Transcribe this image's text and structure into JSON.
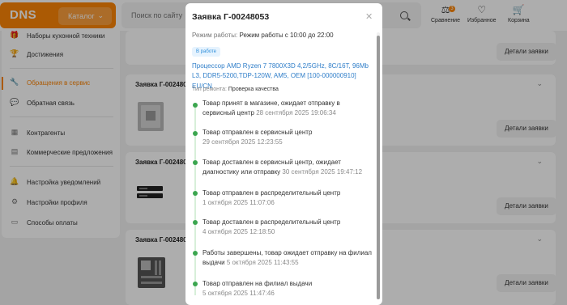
{
  "header": {
    "logo": "DNS",
    "catalog_label": "Каталог",
    "search_placeholder": "Поиск по сайту",
    "compare_label": "Сравнение",
    "compare_count": "3",
    "favorites_label": "Избранное",
    "cart_label": "Корзина"
  },
  "sidebar": {
    "items": [
      {
        "label": "Наборы кухонной техники",
        "icon": "gift-icon"
      },
      {
        "label": "Достижения",
        "icon": "trophy-icon"
      },
      {
        "label": "Обращения в сервис",
        "icon": "wrench-icon",
        "active": true
      },
      {
        "label": "Обратная связь",
        "icon": "chat-icon"
      },
      {
        "label": "Контрагенты",
        "icon": "building-icon"
      },
      {
        "label": "Коммерческие предложения",
        "icon": "document-icon"
      },
      {
        "label": "Настройка уведомлений",
        "icon": "bell-icon"
      },
      {
        "label": "Настройки профиля",
        "icon": "gear-icon"
      },
      {
        "label": "Способы оплаты",
        "icon": "wallet-icon"
      }
    ]
  },
  "main": {
    "details_label": "Детали заявки",
    "cards": [
      {
        "title": "Заявка Г-002480"
      },
      {
        "title": "Заявка Г-002480"
      },
      {
        "title": "Заявка Г-002480"
      }
    ]
  },
  "modal": {
    "title": "Заявка Г-00248053",
    "hours_label": "Режим работы:",
    "hours_value": "Режим работы с 10:00 до 22:00",
    "status": "В работе",
    "product": "Процессор AMD Ryzen 7 7800X3D 4,2/5GHz, 8C/16T, 96Mb L3, DDR5-5200,TDP-120W, AM5, OEM [100-000000910] EU/CN",
    "repair_label": "Тип ремонта:",
    "repair_value": "Проверка качества",
    "timeline": [
      {
        "text": "Товар принят в магазине, ожидает отправку в сервисный центр",
        "date": "28 сентября 2025 19:06:34"
      },
      {
        "text": "Товар отправлен в сервисный центр",
        "date": "29 сентября 2025 12:23:55"
      },
      {
        "text": "Товар доставлен в сервисный центр, ожидает диагностику или отправку",
        "date": "30 сентября 2025 19:47:12"
      },
      {
        "text": "Товар отправлен в распределительный центр",
        "date": "1 октября 2025 11:07:06"
      },
      {
        "text": "Товар доставлен в распределительный центр",
        "date": "4 октября 2025 12:18:50"
      },
      {
        "text": "Работы завершены, товар ожидает отправку на филиал выдачи",
        "date": "5 октября 2025 11:43:55"
      },
      {
        "text": "Товар отправлен на филиал выдачи",
        "date": "5 октября 2025 11:47:46"
      }
    ]
  },
  "colors": {
    "accent": "#fc8507",
    "link": "#2f7ec9",
    "timeline": "#3ba64f"
  }
}
